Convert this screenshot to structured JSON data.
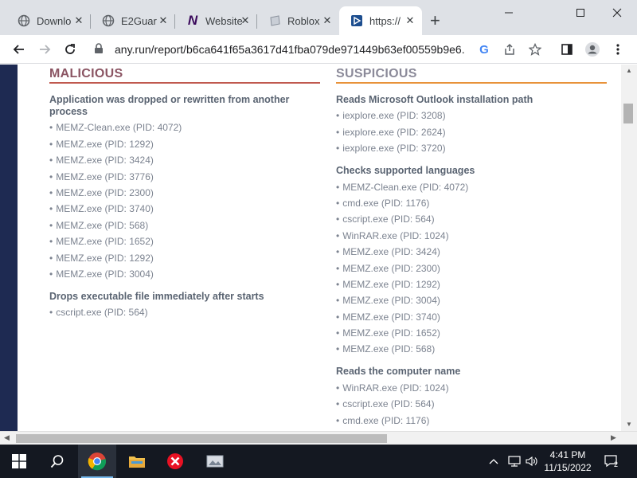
{
  "browser": {
    "tabs": [
      {
        "title": "Downlo"
      },
      {
        "title": "E2Guar"
      },
      {
        "title": "Website"
      },
      {
        "title": "Roblox"
      },
      {
        "title": "https://"
      }
    ],
    "url": "any.run/report/b6ca641f65a3617d41fba079de971449b63ef00559b9e6..."
  },
  "report": {
    "malicious": {
      "heading": "MALICIOUS",
      "groups": [
        {
          "title": "Application was dropped or rewritten from another process",
          "items": [
            "MEMZ-Clean.exe (PID: 4072)",
            "MEMZ.exe (PID: 1292)",
            "MEMZ.exe (PID: 3424)",
            "MEMZ.exe (PID: 3776)",
            "MEMZ.exe (PID: 2300)",
            "MEMZ.exe (PID: 3740)",
            "MEMZ.exe (PID: 568)",
            "MEMZ.exe (PID: 1652)",
            "MEMZ.exe (PID: 1292)",
            "MEMZ.exe (PID: 3004)"
          ]
        },
        {
          "title": "Drops executable file immediately after starts",
          "items": [
            "cscript.exe (PID: 564)"
          ]
        }
      ]
    },
    "suspicious": {
      "heading": "SUSPICIOUS",
      "groups": [
        {
          "title": "Reads Microsoft Outlook installation path",
          "items": [
            "iexplore.exe (PID: 3208)",
            "iexplore.exe (PID: 2624)",
            "iexplore.exe (PID: 3720)"
          ]
        },
        {
          "title": "Checks supported languages",
          "items": [
            "MEMZ-Clean.exe (PID: 4072)",
            "cmd.exe (PID: 1176)",
            "cscript.exe (PID: 564)",
            "WinRAR.exe (PID: 1024)",
            "MEMZ.exe (PID: 3424)",
            "MEMZ.exe (PID: 2300)",
            "MEMZ.exe (PID: 1292)",
            "MEMZ.exe (PID: 3004)",
            "MEMZ.exe (PID: 3740)",
            "MEMZ.exe (PID: 1652)",
            "MEMZ.exe (PID: 568)"
          ]
        },
        {
          "title": "Reads the computer name",
          "items": [
            "WinRAR.exe (PID: 1024)",
            "cscript.exe (PID: 564)",
            "cmd.exe (PID: 1176)"
          ]
        }
      ]
    }
  },
  "taskbar": {
    "time": "4:41 PM",
    "date": "11/15/2022",
    "notifications": "2"
  },
  "colors": {
    "malicious_accent": "#c0594f",
    "suspicious_accent": "#e8923a",
    "page_bg": "#1e2a52"
  }
}
